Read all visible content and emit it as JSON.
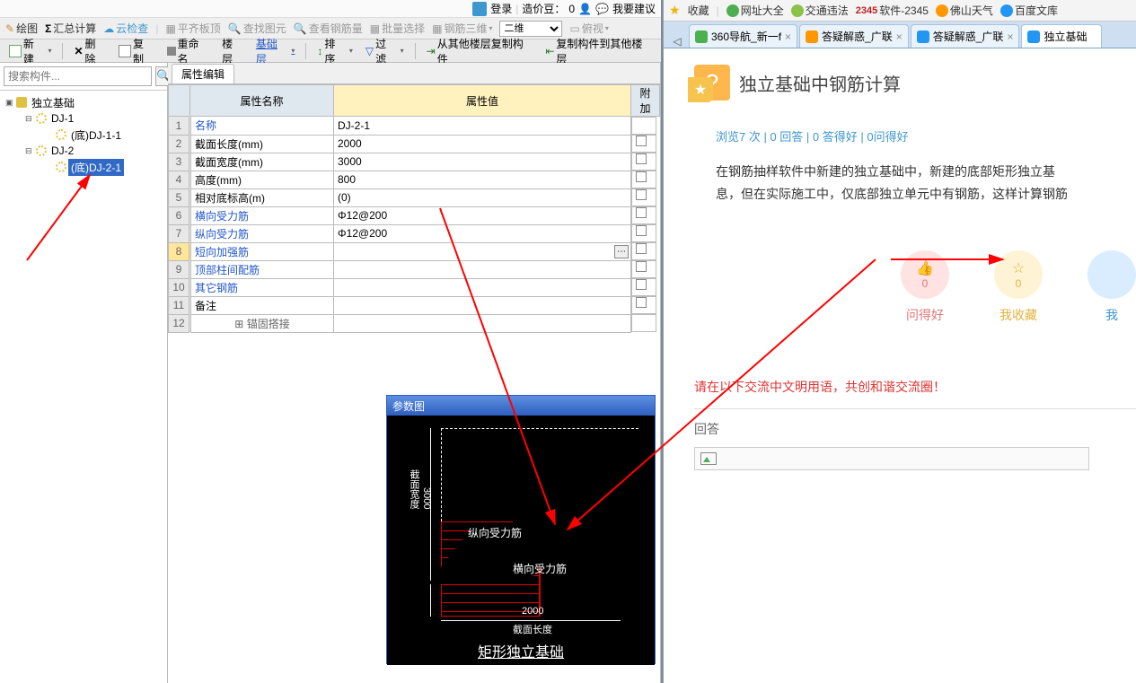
{
  "topbar": {
    "login": "登录",
    "bean_label": "造价豆：",
    "bean_value": "0",
    "suggest": "我要建议"
  },
  "toolbar2": {
    "draw": "绘图",
    "sigma": "Σ",
    "sum": "汇总计算",
    "cloud": "云检查",
    "flatten": "平齐板顶",
    "findfig": "查找图元",
    "findbar": "查看钢筋量",
    "batchsel": "批量选择",
    "bar3d": "钢筋三维",
    "dim_sel": "二维",
    "view_mode": "俯视"
  },
  "toolbar3": {
    "new": "新建",
    "delete": "删除",
    "copy": "复制",
    "rename": "重命名",
    "floor": "楼层",
    "baselayer": "基础层",
    "sort": "排序",
    "filter": "过滤",
    "copyfrom": "从其他楼层复制构件",
    "copyto": "复制构件到其他楼层"
  },
  "search": {
    "placeholder": "搜索构件..."
  },
  "tree": {
    "root": "独立基础",
    "dj1": "DJ-1",
    "dj1c": "(底)DJ-1-1",
    "dj2": "DJ-2",
    "dj2c": "(底)DJ-2-1"
  },
  "prop": {
    "tab": "属性编辑",
    "h_name": "属性名称",
    "h_value": "属性值",
    "h_app": "附加",
    "rows": [
      {
        "n": "1",
        "name": "名称",
        "val": "DJ-2-1",
        "link": true
      },
      {
        "n": "2",
        "name": "截面长度(mm)",
        "val": "2000"
      },
      {
        "n": "3",
        "name": "截面宽度(mm)",
        "val": "3000"
      },
      {
        "n": "4",
        "name": "高度(mm)",
        "val": "800"
      },
      {
        "n": "5",
        "name": "相对底标高(m)",
        "val": "(0)"
      },
      {
        "n": "6",
        "name": "横向受力筋",
        "val": "Φ12@200",
        "link": true
      },
      {
        "n": "7",
        "name": "纵向受力筋",
        "val": "Φ12@200",
        "link": true
      },
      {
        "n": "8",
        "name": "短向加强筋",
        "val": "",
        "link": true,
        "active": true
      },
      {
        "n": "9",
        "name": "顶部柱间配筋",
        "val": "",
        "link": true
      },
      {
        "n": "10",
        "name": "其它钢筋",
        "val": "",
        "link": true
      },
      {
        "n": "11",
        "name": "备注",
        "val": ""
      },
      {
        "n": "12",
        "name": "锚固搭接",
        "val": "",
        "gray": true,
        "exp": true
      }
    ]
  },
  "param": {
    "title": "参数图",
    "lbl_zong": "纵向受力筋",
    "lbl_heng": "横向受力筋",
    "dim_w": "2000",
    "dim_wlbl": "截面长度",
    "dim_h": "3000",
    "dim_hlbl": "截面宽度",
    "foot": "矩形独立基础"
  },
  "browser": {
    "top": {
      "fav": "收藏",
      "sites": "网址大全",
      "traffic": "交通违法",
      "softlbl": "软件-2345",
      "weather": "佛山天气",
      "baidu": "百度文库"
    },
    "tabs": [
      {
        "label": "360导航_新一f",
        "ico": "n360"
      },
      {
        "label": "答疑解惑_广联",
        "ico": "q"
      },
      {
        "label": "答疑解惑_广联",
        "ico": "q2"
      },
      {
        "label": "独立基础",
        "ico": "q3",
        "active": true
      }
    ],
    "page": {
      "title": "独立基础中钢筋计算",
      "stats_browse": "浏览7 次",
      "stats_reply": "0 回答",
      "stats_good": "0 答得好",
      "stats_qgood": "0问得好",
      "line1": "在钢筋抽样软件中新建的独立基础中，新建的底部矩形独立基",
      "line2": "息，但在实际施工中，仅底部独立单元中有钢筋，这样计算钢筋",
      "rate_ask": "问得好",
      "rate_fav": "我收藏",
      "rate_me": "我",
      "zero": "0",
      "notice": "请在以下交流中文明用语，共创和谐交流圈！",
      "answer": "回答"
    }
  }
}
